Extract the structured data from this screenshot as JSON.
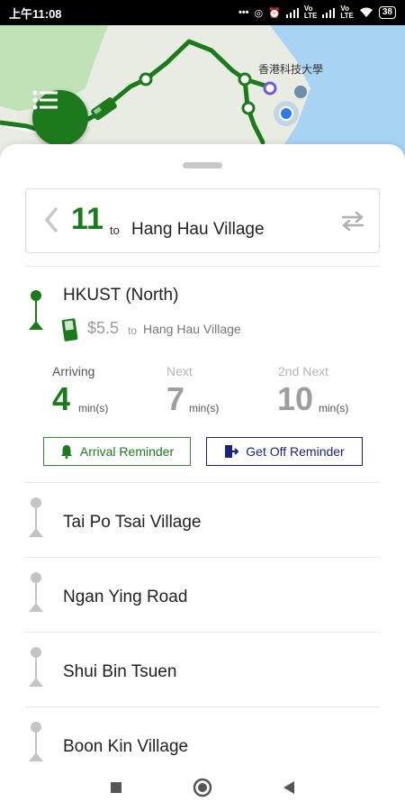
{
  "status_bar": {
    "time": "上午11:08",
    "icons": [
      "more-dots-icon",
      "sync-icon",
      "alarm-icon",
      "signal-icon",
      "volte-icon",
      "signal-icon",
      "volte-icon",
      "wifi-icon"
    ],
    "battery": "38"
  },
  "map": {
    "label": "香港科技大學",
    "route_color": "#1c7a1c"
  },
  "route": {
    "number": "11",
    "to_word": "to",
    "destination": "Hang Hau Village"
  },
  "current_stop": {
    "name": "HKUST (North)",
    "fare": "$5.5",
    "fare_to_word": "to",
    "fare_destination": "Hang Hau Village"
  },
  "eta": [
    {
      "label": "Arriving",
      "value": "4",
      "unit": "min(s)"
    },
    {
      "label": "Next",
      "value": "7",
      "unit": "min(s)"
    },
    {
      "label": "2nd Next",
      "value": "10",
      "unit": "min(s)"
    }
  ],
  "buttons": {
    "arrival_reminder": "Arrival Reminder",
    "get_off_reminder": "Get Off Reminder"
  },
  "stops": [
    "Tai Po Tsai Village",
    "Ngan Ying Road",
    "Shui Bin Tsuen",
    "Boon Kin Village"
  ],
  "colors": {
    "accent": "#1c7a1c",
    "get_off": "#1a237e",
    "inactive_stop": "#c4c4c4"
  }
}
